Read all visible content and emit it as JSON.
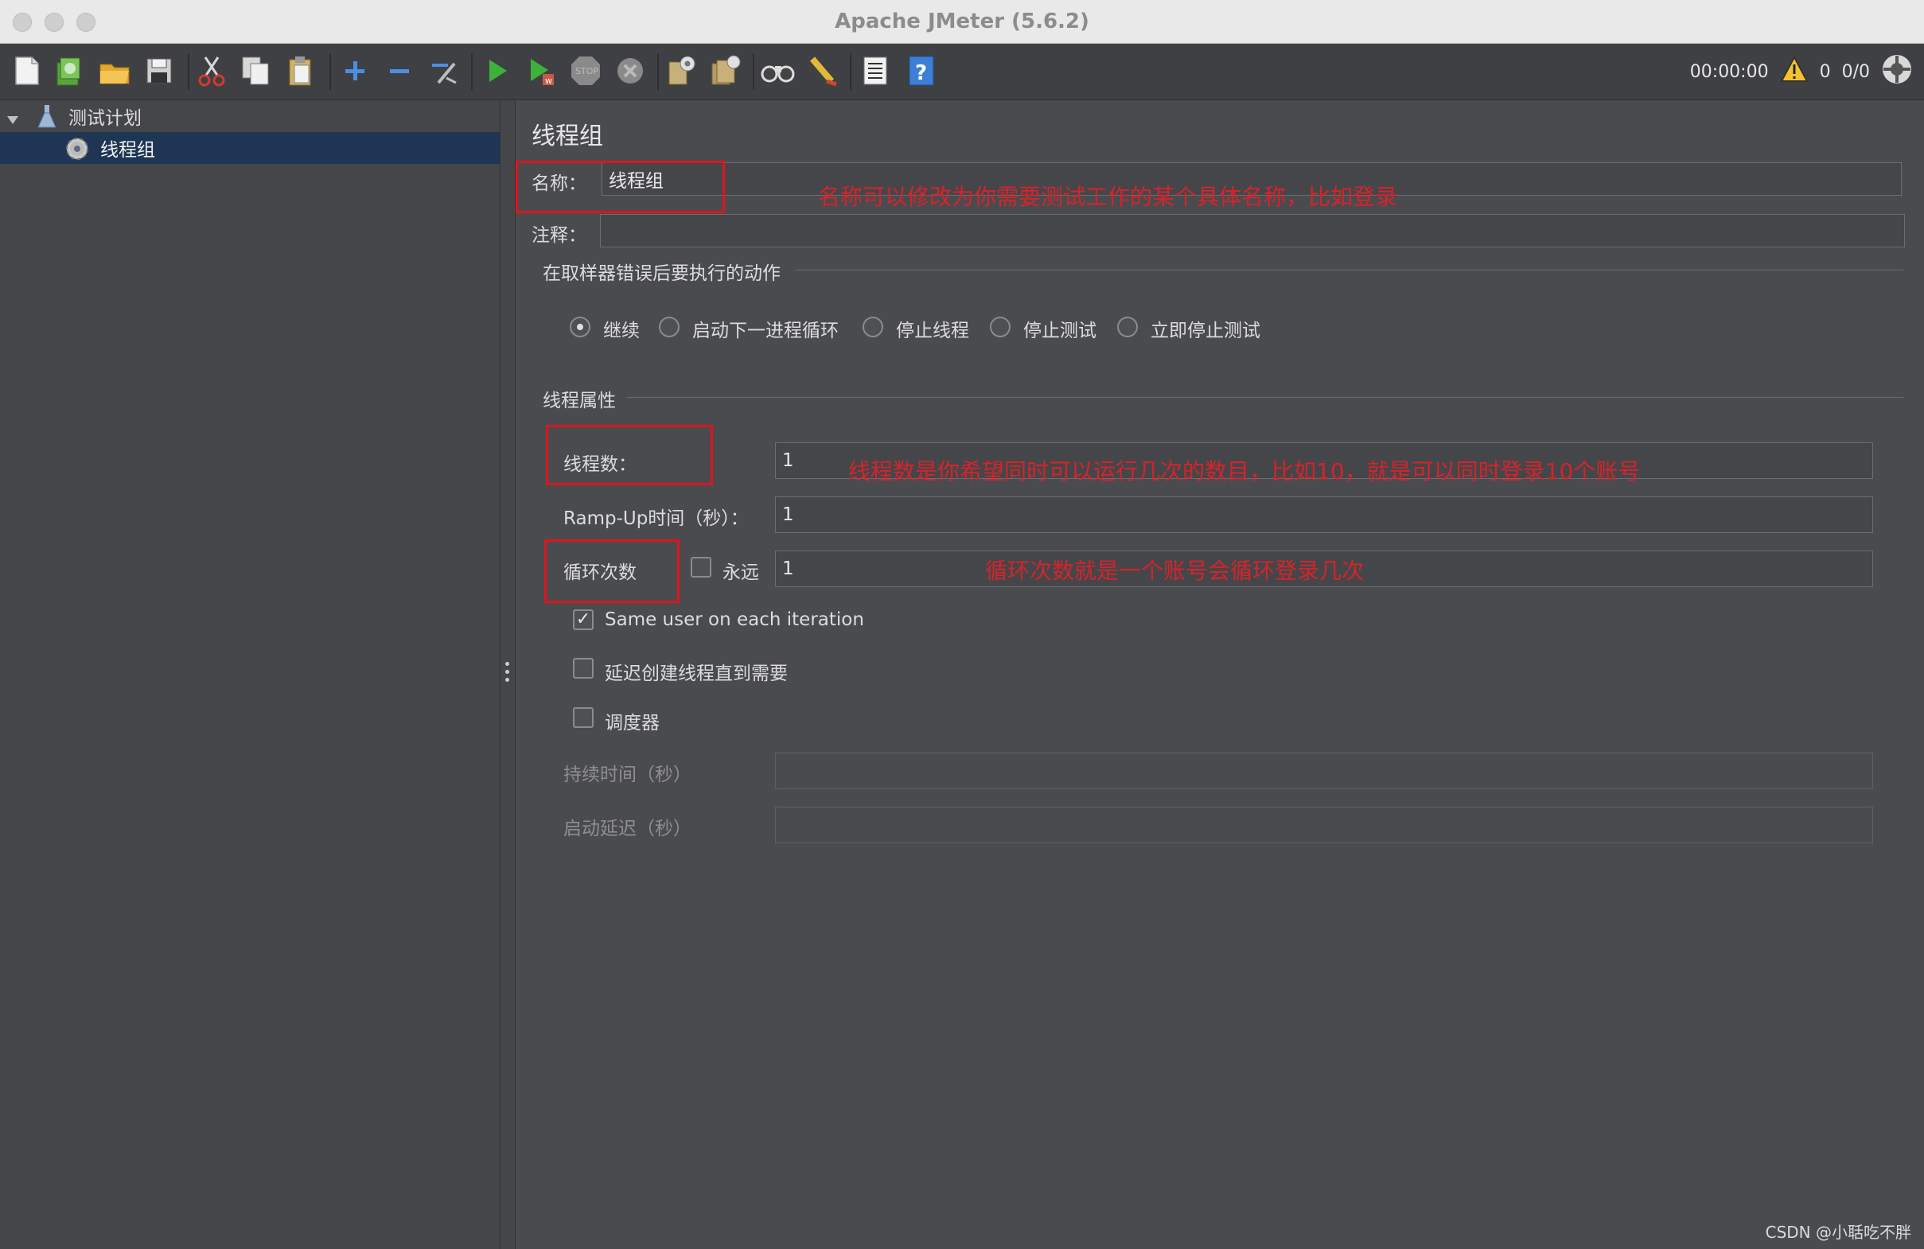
{
  "window": {
    "title": "Apache JMeter (5.6.2)"
  },
  "toolbar": {
    "buttons": [
      {
        "name": "new-icon",
        "color": "#f2f2f2"
      },
      {
        "name": "templates-icon",
        "color": "#5aa33c"
      },
      {
        "name": "open-icon",
        "color": "#e3a72a"
      },
      {
        "name": "save-icon",
        "color": "#cfcfcf"
      },
      {
        "name": "cut-icon",
        "color": "#d33a2f"
      },
      {
        "name": "copy-icon",
        "color": "#d8d8d8"
      },
      {
        "name": "paste-icon",
        "color": "#d0b36a"
      },
      {
        "name": "expand-icon",
        "color": "#4c8fe0"
      },
      {
        "name": "collapse-icon",
        "color": "#4c8fe0"
      },
      {
        "name": "toggle-icon",
        "color": "#bdbdbd"
      },
      {
        "name": "start-icon",
        "color": "#3fb13a"
      },
      {
        "name": "start-no-pause-icon",
        "color": "#3fb13a"
      },
      {
        "name": "stop-icon",
        "color": "#8a8a8a"
      },
      {
        "name": "shutdown-icon",
        "color": "#8a8a8a"
      },
      {
        "name": "clear-icon",
        "color": "#c8b07a"
      },
      {
        "name": "clear-all-icon",
        "color": "#c8b07a"
      },
      {
        "name": "search-icon",
        "color": "#cfcfcf"
      },
      {
        "name": "reset-search-icon",
        "color": "#e0b93a"
      },
      {
        "name": "function-helper-icon",
        "color": "#e6e6e6"
      },
      {
        "name": "help-icon",
        "color": "#3e7fd6"
      }
    ],
    "elapsed_time": "00:00:00",
    "warning_count": "0",
    "threads_status": "0/0"
  },
  "tree": {
    "items": [
      {
        "label": "测试计划",
        "icon": "flask-icon"
      },
      {
        "label": "线程组",
        "icon": "gear-icon"
      }
    ]
  },
  "panel": {
    "title": "线程组",
    "name_label": "名称：",
    "name_value": "线程组",
    "comment_label": "注释：",
    "comment_value": "",
    "error_section": "在取样器错误后要执行的动作",
    "error_actions": [
      {
        "label": "继续",
        "selected": true
      },
      {
        "label": "启动下一进程循环",
        "selected": false
      },
      {
        "label": "停止线程",
        "selected": false
      },
      {
        "label": "停止测试",
        "selected": false
      },
      {
        "label": "立即停止测试",
        "selected": false
      }
    ],
    "thread_section": "线程属性",
    "threads_label": "线程数：",
    "threads_value": "1",
    "rampup_label": "Ramp-Up时间（秒）：",
    "rampup_value": "1",
    "loop_label": "循环次数",
    "forever_label": "永远",
    "forever_checked": false,
    "loop_value": "1",
    "same_user_label": "Same user on each iteration",
    "same_user_checked": true,
    "delay_label": "延迟创建线程直到需要",
    "delay_checked": false,
    "scheduler_label": "调度器",
    "scheduler_checked": false,
    "duration_label": "持续时间（秒）",
    "duration_value": "",
    "startup_delay_label": "启动延迟（秒）",
    "startup_delay_value": ""
  },
  "annotations": {
    "name_note": "名称可以修改为你需要测试工作的某个具体名称，比如登录",
    "threads_note": "线程数是你希望同时可以运行几次的数目，比如10，就是可以同时登录10个账号",
    "loop_note": "循环次数就是一个账号会循环登录几次",
    "color": "#d6232a"
  },
  "watermark": "CSDN @小聒吃不胖"
}
